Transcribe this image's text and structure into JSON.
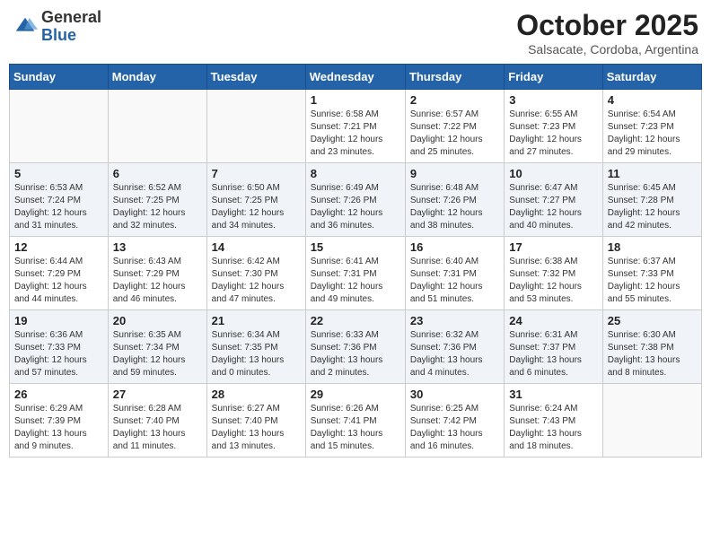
{
  "logo": {
    "general": "General",
    "blue": "Blue"
  },
  "title": "October 2025",
  "location": "Salsacate, Cordoba, Argentina",
  "days_of_week": [
    "Sunday",
    "Monday",
    "Tuesday",
    "Wednesday",
    "Thursday",
    "Friday",
    "Saturday"
  ],
  "weeks": [
    [
      {
        "day": "",
        "info": ""
      },
      {
        "day": "",
        "info": ""
      },
      {
        "day": "",
        "info": ""
      },
      {
        "day": "1",
        "info": "Sunrise: 6:58 AM\nSunset: 7:21 PM\nDaylight: 12 hours\nand 23 minutes."
      },
      {
        "day": "2",
        "info": "Sunrise: 6:57 AM\nSunset: 7:22 PM\nDaylight: 12 hours\nand 25 minutes."
      },
      {
        "day": "3",
        "info": "Sunrise: 6:55 AM\nSunset: 7:23 PM\nDaylight: 12 hours\nand 27 minutes."
      },
      {
        "day": "4",
        "info": "Sunrise: 6:54 AM\nSunset: 7:23 PM\nDaylight: 12 hours\nand 29 minutes."
      }
    ],
    [
      {
        "day": "5",
        "info": "Sunrise: 6:53 AM\nSunset: 7:24 PM\nDaylight: 12 hours\nand 31 minutes."
      },
      {
        "day": "6",
        "info": "Sunrise: 6:52 AM\nSunset: 7:25 PM\nDaylight: 12 hours\nand 32 minutes."
      },
      {
        "day": "7",
        "info": "Sunrise: 6:50 AM\nSunset: 7:25 PM\nDaylight: 12 hours\nand 34 minutes."
      },
      {
        "day": "8",
        "info": "Sunrise: 6:49 AM\nSunset: 7:26 PM\nDaylight: 12 hours\nand 36 minutes."
      },
      {
        "day": "9",
        "info": "Sunrise: 6:48 AM\nSunset: 7:26 PM\nDaylight: 12 hours\nand 38 minutes."
      },
      {
        "day": "10",
        "info": "Sunrise: 6:47 AM\nSunset: 7:27 PM\nDaylight: 12 hours\nand 40 minutes."
      },
      {
        "day": "11",
        "info": "Sunrise: 6:45 AM\nSunset: 7:28 PM\nDaylight: 12 hours\nand 42 minutes."
      }
    ],
    [
      {
        "day": "12",
        "info": "Sunrise: 6:44 AM\nSunset: 7:29 PM\nDaylight: 12 hours\nand 44 minutes."
      },
      {
        "day": "13",
        "info": "Sunrise: 6:43 AM\nSunset: 7:29 PM\nDaylight: 12 hours\nand 46 minutes."
      },
      {
        "day": "14",
        "info": "Sunrise: 6:42 AM\nSunset: 7:30 PM\nDaylight: 12 hours\nand 47 minutes."
      },
      {
        "day": "15",
        "info": "Sunrise: 6:41 AM\nSunset: 7:31 PM\nDaylight: 12 hours\nand 49 minutes."
      },
      {
        "day": "16",
        "info": "Sunrise: 6:40 AM\nSunset: 7:31 PM\nDaylight: 12 hours\nand 51 minutes."
      },
      {
        "day": "17",
        "info": "Sunrise: 6:38 AM\nSunset: 7:32 PM\nDaylight: 12 hours\nand 53 minutes."
      },
      {
        "day": "18",
        "info": "Sunrise: 6:37 AM\nSunset: 7:33 PM\nDaylight: 12 hours\nand 55 minutes."
      }
    ],
    [
      {
        "day": "19",
        "info": "Sunrise: 6:36 AM\nSunset: 7:33 PM\nDaylight: 12 hours\nand 57 minutes."
      },
      {
        "day": "20",
        "info": "Sunrise: 6:35 AM\nSunset: 7:34 PM\nDaylight: 12 hours\nand 59 minutes."
      },
      {
        "day": "21",
        "info": "Sunrise: 6:34 AM\nSunset: 7:35 PM\nDaylight: 13 hours\nand 0 minutes."
      },
      {
        "day": "22",
        "info": "Sunrise: 6:33 AM\nSunset: 7:36 PM\nDaylight: 13 hours\nand 2 minutes."
      },
      {
        "day": "23",
        "info": "Sunrise: 6:32 AM\nSunset: 7:36 PM\nDaylight: 13 hours\nand 4 minutes."
      },
      {
        "day": "24",
        "info": "Sunrise: 6:31 AM\nSunset: 7:37 PM\nDaylight: 13 hours\nand 6 minutes."
      },
      {
        "day": "25",
        "info": "Sunrise: 6:30 AM\nSunset: 7:38 PM\nDaylight: 13 hours\nand 8 minutes."
      }
    ],
    [
      {
        "day": "26",
        "info": "Sunrise: 6:29 AM\nSunset: 7:39 PM\nDaylight: 13 hours\nand 9 minutes."
      },
      {
        "day": "27",
        "info": "Sunrise: 6:28 AM\nSunset: 7:40 PM\nDaylight: 13 hours\nand 11 minutes."
      },
      {
        "day": "28",
        "info": "Sunrise: 6:27 AM\nSunset: 7:40 PM\nDaylight: 13 hours\nand 13 minutes."
      },
      {
        "day": "29",
        "info": "Sunrise: 6:26 AM\nSunset: 7:41 PM\nDaylight: 13 hours\nand 15 minutes."
      },
      {
        "day": "30",
        "info": "Sunrise: 6:25 AM\nSunset: 7:42 PM\nDaylight: 13 hours\nand 16 minutes."
      },
      {
        "day": "31",
        "info": "Sunrise: 6:24 AM\nSunset: 7:43 PM\nDaylight: 13 hours\nand 18 minutes."
      },
      {
        "day": "",
        "info": ""
      }
    ]
  ]
}
